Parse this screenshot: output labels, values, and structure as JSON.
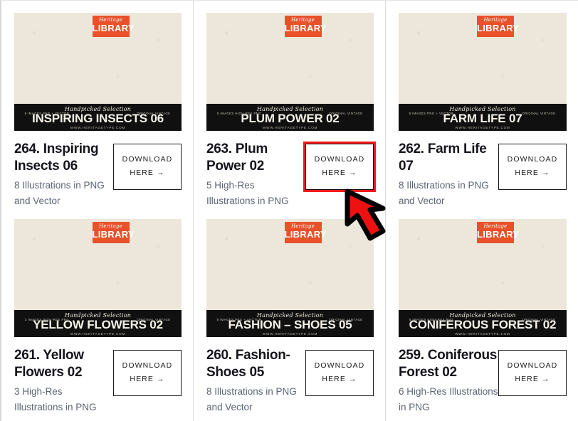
{
  "page": {
    "brand_badge": {
      "script": "Heritage",
      "word": "LIBRARY"
    },
    "accent_color": "#e8512a",
    "highlight_color": "#f41a1a",
    "cursor": {
      "name": "red-arrow-cursor",
      "points_to": "download-here-button-plum-power-02"
    }
  },
  "cards": [
    {
      "number": "264.",
      "title": "264. Inspiring Insects 06",
      "description": "8 Illustrations in PNG and Vector",
      "banner": {
        "handpicked": "Handpicked Selection",
        "name": "INSPIRING INSECTS 06",
        "url": "WWW.HERITAGETYPE.COM",
        "left_badge": "8 IMAGES PNG + VECTOR",
        "right_badge": "ORIGINAL VINTAGE"
      },
      "button": {
        "line1": "DOWNLOAD",
        "line2": "HERE →",
        "highlighted": false
      }
    },
    {
      "number": "263.",
      "title": "263. Plum Power 02",
      "description": "5 High-Res Illustrations in PNG",
      "banner": {
        "handpicked": "Handpicked Selection",
        "name": "PLUM POWER 02",
        "url": "WWW.HERITAGETYPE.COM",
        "left_badge": "5 IMAGES HIGH-RES PNG",
        "right_badge": "ORIGINAL VINTAGE"
      },
      "button": {
        "line1": "DOWNLOAD",
        "line2": "HERE →",
        "highlighted": true
      }
    },
    {
      "number": "262.",
      "title": "262. Farm Life 07",
      "description": "8 Illustrations in PNG and Vector",
      "banner": {
        "handpicked": "Handpicked Selection",
        "name": "FARM LIFE 07",
        "url": "WWW.HERITAGETYPE.COM",
        "left_badge": "8 IMAGES PNG + VECTOR",
        "right_badge": "ORIGINAL VINTAGE"
      },
      "button": {
        "line1": "DOWNLOAD",
        "line2": "HERE →",
        "highlighted": false
      }
    },
    {
      "number": "261.",
      "title": "261. Yellow Flowers 02",
      "description": "3 High-Res Illustrations in PNG",
      "banner": {
        "handpicked": "Handpicked Selection",
        "name": "YELLOW FLOWERS 02",
        "url": "WWW.HERITAGETYPE.COM",
        "left_badge": "3 IMAGES HIGH-RES PNG",
        "right_badge": "ORIGINAL VINTAGE"
      },
      "button": {
        "line1": "DOWNLOAD",
        "line2": "HERE →",
        "highlighted": false
      }
    },
    {
      "number": "260.",
      "title": "260. Fashion-Shoes 05",
      "description": "8 Illustrations in PNG and Vector",
      "banner": {
        "handpicked": "Handpicked Selection",
        "name": "FASHION – SHOES 05",
        "url": "WWW.HERITAGETYPE.COM",
        "left_badge": "8 IMAGES PNG + VECTOR",
        "right_badge": "ORIGINAL VINTAGE"
      },
      "button": {
        "line1": "DOWNLOAD",
        "line2": "HERE →",
        "highlighted": false
      }
    },
    {
      "number": "259.",
      "title": "259. Coniferous Forest 02",
      "description": "6 High-Res Illustrations in PNG",
      "banner": {
        "handpicked": "Handpicked Selection",
        "name": "CONIFEROUS FOREST 02",
        "url": "WWW.HERITAGETYPE.COM",
        "left_badge": "6 IMAGES HIGH-RES PNG",
        "right_badge": "ORIGINAL VINTAGE"
      },
      "button": {
        "line1": "DOWNLOAD",
        "line2": "HERE →",
        "highlighted": false
      }
    }
  ]
}
